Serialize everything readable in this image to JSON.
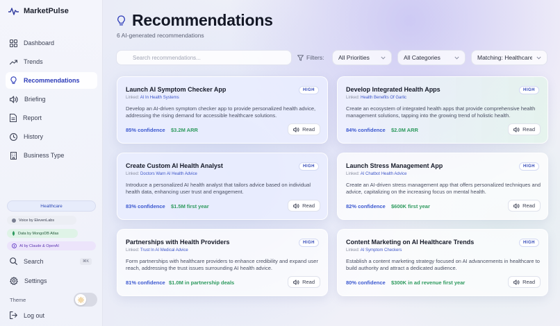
{
  "app": {
    "name": "MarketPulse"
  },
  "sidebar": {
    "items": [
      {
        "label": "Dashboard",
        "icon": "grid-icon"
      },
      {
        "label": "Trends",
        "icon": "trend-icon"
      },
      {
        "label": "Recommendations",
        "icon": "lightbulb-icon",
        "active": true
      },
      {
        "label": "Briefing",
        "icon": "speaker-icon"
      },
      {
        "label": "Report",
        "icon": "document-icon"
      },
      {
        "label": "History",
        "icon": "clock-icon"
      },
      {
        "label": "Business Type",
        "icon": "building-icon"
      }
    ],
    "industry": "Healthcare",
    "credits": {
      "voice": "Voice by ElevenLabs",
      "mongo": "Data by MongoDB Atlas",
      "ai": "AI by Claude & OpenAI"
    },
    "search_label": "Search",
    "search_shortcut": "⌘K",
    "settings_label": "Settings",
    "theme_label": "Theme",
    "logout_label": "Log out"
  },
  "main": {
    "title": "Recommendations",
    "subtitle": "6 AI-generated recommendations",
    "search_placeholder": "Search recommendations...",
    "filters_label": "Filters:",
    "filter_priority": "All Priorities",
    "filter_category": "All Categories",
    "filter_matching": "Matching: Healthcare"
  },
  "cards": [
    {
      "title": "Launch AI Symptom Checker App",
      "priority": "HIGH",
      "linked_prefix": "Linked:",
      "linked": "AI In Health Systems",
      "description": "Develop an AI-driven symptom checker app to provide personalized health advice, addressing the rising demand for accessible healthcare solutions.",
      "confidence": "85% confidence",
      "value": "$3.2M ARR",
      "read_label": "Read"
    },
    {
      "title": "Develop Integrated Health Apps",
      "priority": "HIGH",
      "linked_prefix": "Linked:",
      "linked": "Health Benefits Of Garlic",
      "description": "Create an ecosystem of integrated health apps that provide comprehensive health management solutions, tapping into the growing trend of holistic health.",
      "confidence": "84% confidence",
      "value": "$2.0M ARR",
      "read_label": "Read"
    },
    {
      "title": "Create Custom AI Health Analyst",
      "priority": "HIGH",
      "linked_prefix": "Linked:",
      "linked": "Doctors Warn AI Health Advice",
      "description": "Introduce a personalized AI health analyst that tailors advice based on individual health data, enhancing user trust and engagement.",
      "confidence": "83% confidence",
      "value": "$1.5M first year",
      "read_label": "Read"
    },
    {
      "title": "Launch Stress Management App",
      "priority": "HIGH",
      "linked_prefix": "Linked:",
      "linked": "AI Chatbot Health Advice",
      "description": "Create an AI-driven stress management app that offers personalized techniques and advice, capitalizing on the increasing focus on mental health.",
      "confidence": "82% confidence",
      "value": "$600K first year",
      "read_label": "Read"
    },
    {
      "title": "Partnerships with Health Providers",
      "priority": "HIGH",
      "linked_prefix": "Linked:",
      "linked": "Trust In AI Medical Advice",
      "description": "Form partnerships with healthcare providers to enhance credibility and expand user reach, addressing the trust issues surrounding AI health advice.",
      "confidence": "81% confidence",
      "value": "$1.0M in partnership deals",
      "read_label": "Read"
    },
    {
      "title": "Content Marketing on AI Healthcare Trends",
      "priority": "HIGH",
      "linked_prefix": "Linked:",
      "linked": "AI Symptom Checkers",
      "description": "Establish a content marketing strategy focused on AI advancements in healthcare to build authority and attract a dedicated audience.",
      "confidence": "80% confidence",
      "value": "$300K in ad revenue first year",
      "read_label": "Read"
    }
  ],
  "colors": {
    "accent": "#2b3ab8",
    "confidence": "#3b58d0",
    "value": "#2e9a5e"
  }
}
